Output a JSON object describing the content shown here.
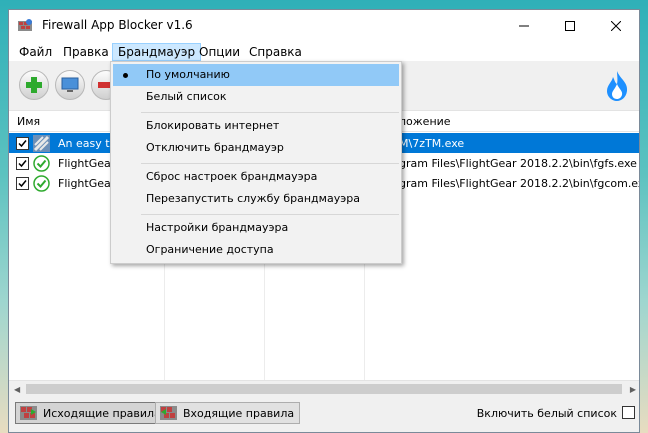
{
  "window": {
    "title": "Firewall App Blocker v1.6"
  },
  "menu": {
    "items": [
      "Файл",
      "Правка",
      "Брандмауэр",
      "Опции",
      "Справка"
    ]
  },
  "dropdown": {
    "items": [
      "По умолчанию",
      "Белый список",
      "Блокировать интернет",
      "Отключить брандмауэр",
      "Сброс настроек брандмауэра",
      "Перезапустить службу брандмауэра",
      "Настройки брандмауэра",
      "Ограничение доступа"
    ],
    "checked": "По умолчанию"
  },
  "list": {
    "headers": {
      "name": "Имя",
      "path": "ложение"
    },
    "rows": [
      {
        "name": "An easy to",
        "path": "M\\7zTM.exe",
        "selected": true,
        "icon": "blocked-app-icon"
      },
      {
        "name": "FlightGear",
        "path": "gram Files\\FlightGear 2018.2.2\\bin\\fgfs.exe",
        "selected": false,
        "icon": "allowed-check-icon"
      },
      {
        "name": "FlightGear",
        "path": "gram Files\\FlightGear 2018.2.2\\bin\\fgcom.exe",
        "selected": false,
        "icon": "allowed-check-icon"
      }
    ]
  },
  "bottom": {
    "outgoing": "Исходящие правила",
    "incoming": "Входящие правила",
    "whitelist": "Включить белый список"
  },
  "colors": {
    "selection": "#0078d7",
    "menu_highlight": "#91c9f7",
    "accent_flame": "#1e90ff"
  }
}
